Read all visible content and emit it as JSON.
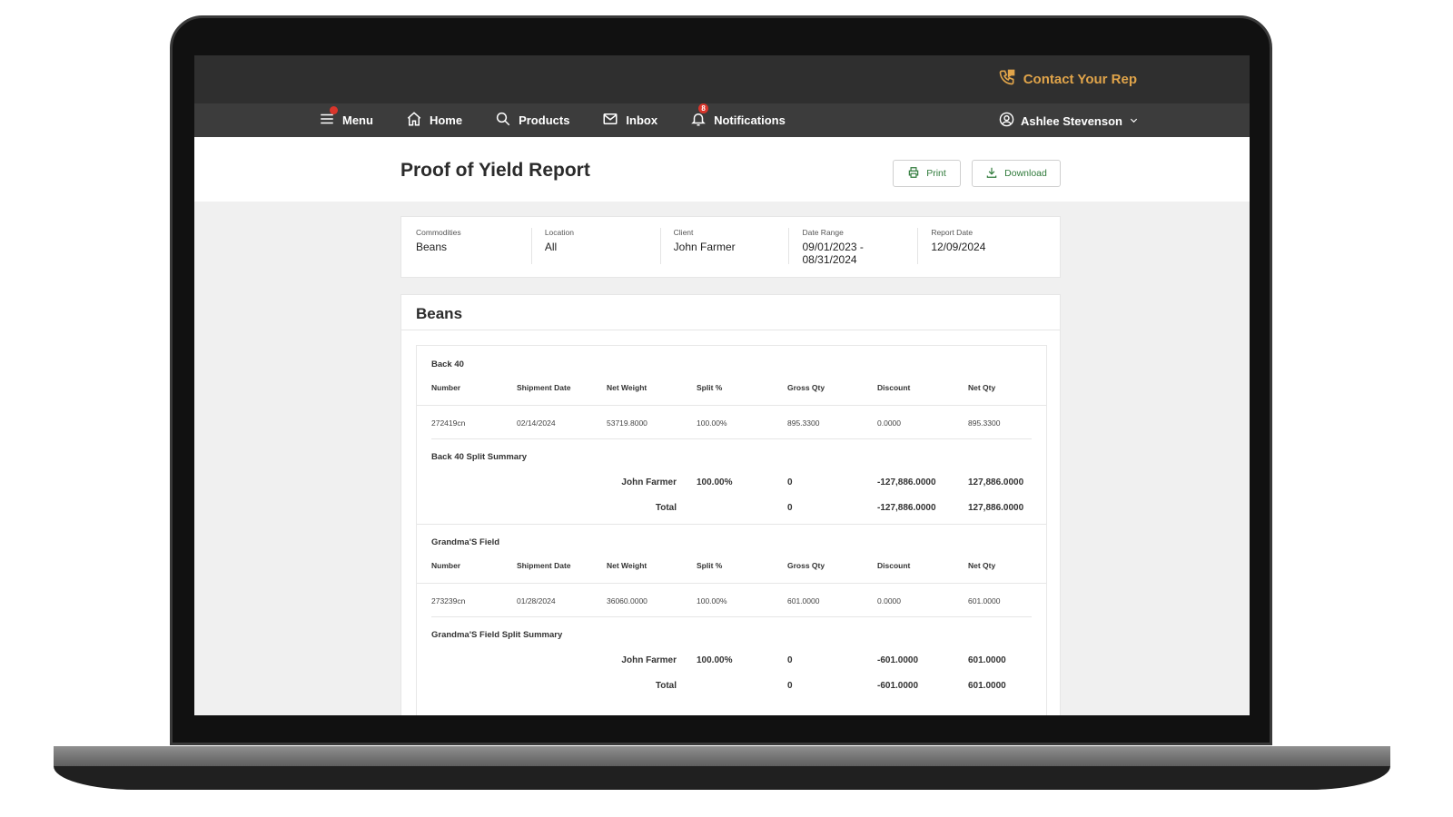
{
  "topbar": {
    "contact_label": "Contact Your Rep"
  },
  "nav": {
    "menu": "Menu",
    "home": "Home",
    "products": "Products",
    "inbox": "Inbox",
    "notifications": "Notifications",
    "notifications_count": "8",
    "user": "Ashlee Stevenson"
  },
  "header": {
    "title": "Proof of Yield Report",
    "print": "Print",
    "download": "Download"
  },
  "filters": [
    {
      "label": "Commodities",
      "value": "Beans"
    },
    {
      "label": "Location",
      "value": "All"
    },
    {
      "label": "Client",
      "value": "John Farmer"
    },
    {
      "label": "Date Range",
      "value_line1": "09/01/2023 -",
      "value_line2": "08/31/2024"
    },
    {
      "label": "Report Date",
      "value": "12/09/2024"
    }
  ],
  "report": {
    "commodity": "Beans",
    "columns": [
      "Number",
      "Shipment Date",
      "Net Weight",
      "Split %",
      "Gross Qty",
      "Discount",
      "Net Qty"
    ],
    "sections": [
      {
        "name": "Back 40",
        "rows": [
          [
            "272419cn",
            "02/14/2024",
            "53719.8000",
            "100.00%",
            "895.3300",
            "0.0000",
            "895.3300"
          ]
        ],
        "summary_title": "Back 40 Split Summary",
        "summary": [
          {
            "name": "John Farmer",
            "split": "100.00%",
            "gross": "0",
            "discount": "-127,886.0000",
            "net": "127,886.0000"
          },
          {
            "name": "Total",
            "split": "",
            "gross": "0",
            "discount": "-127,886.0000",
            "net": "127,886.0000"
          }
        ]
      },
      {
        "name": "Grandma'S Field",
        "rows": [
          [
            "273239cn",
            "01/28/2024",
            "36060.0000",
            "100.00%",
            "601.0000",
            "0.0000",
            "601.0000"
          ]
        ],
        "summary_title": "Grandma'S Field Split Summary",
        "summary": [
          {
            "name": "John Farmer",
            "split": "100.00%",
            "gross": "0",
            "discount": "-601.0000",
            "net": "601.0000"
          },
          {
            "name": "Total",
            "split": "",
            "gross": "0",
            "discount": "-601.0000",
            "net": "601.0000"
          }
        ]
      }
    ]
  },
  "colors": {
    "accent": "#e0a44a",
    "topbar": "#2f2f2f",
    "nav": "#3c3c3c",
    "button_text": "#2f7a3a",
    "badge": "#d9352b"
  }
}
